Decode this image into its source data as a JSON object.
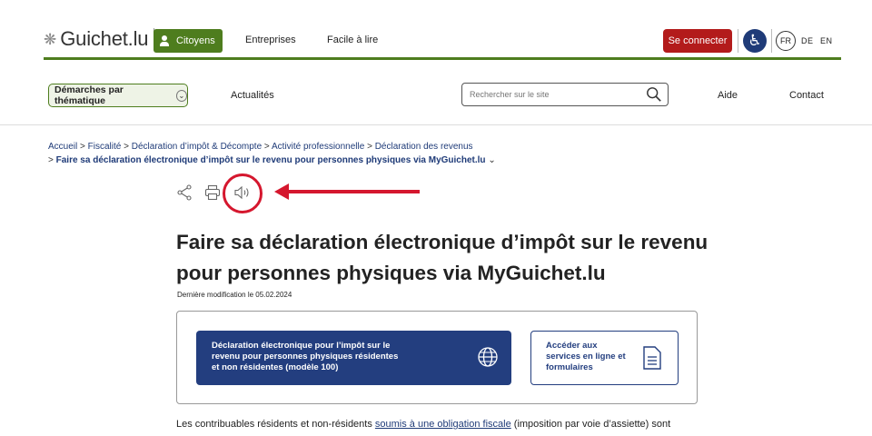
{
  "header": {
    "logo_text": "Guichet.lu",
    "citoyens_label": "Citoyens",
    "entreprises_label": "Entreprises",
    "facile_label": "Facile à lire",
    "login_label": "Se connecter",
    "lang_fr": "FR",
    "lang_de": "DE",
    "lang_en": "EN"
  },
  "subnav": {
    "themes_label": "Démarches par thématique",
    "news_label": "Actualités",
    "search_placeholder": "Rechercher sur le site",
    "help_label": "Aide",
    "contact_label": "Contact"
  },
  "breadcrumb": {
    "items": [
      "Accueil",
      "Fiscalité",
      "Déclaration d’impôt & Décompte",
      "Activité professionnelle",
      "Déclaration des revenus"
    ],
    "current": "Faire sa déclaration électronique d’impôt sur le revenu pour personnes physiques via MyGuichet.lu"
  },
  "page": {
    "title": "Faire sa déclaration électronique d’impôt sur le revenu pour personnes physiques via MyGuichet.lu",
    "modified": "Dernière modification le 05.02.2024",
    "primary_line1": "Déclaration électronique pour l’impôt sur le",
    "primary_line2": "revenu pour personnes physiques résidentes",
    "primary_line3": "et non résidentes (modèle 100)",
    "secondary_line1": "Accéder aux",
    "secondary_line2": "services en ligne et",
    "secondary_line3": "formulaires",
    "body_before": "Les contribuables résidents et non-résidents ",
    "body_link": "soumis à une obligation fiscale",
    "body_after": " (imposition par voie d’assiette) sont"
  },
  "colors": {
    "brand_green": "#4e7d1e",
    "brand_blue": "#233e7f",
    "login_red": "#b31b1b",
    "annotation_red": "#d5172e"
  },
  "icons": [
    "share-icon",
    "print-icon",
    "audio-icon",
    "globe-icon",
    "document-icon",
    "search-icon",
    "accessibility-icon"
  ]
}
